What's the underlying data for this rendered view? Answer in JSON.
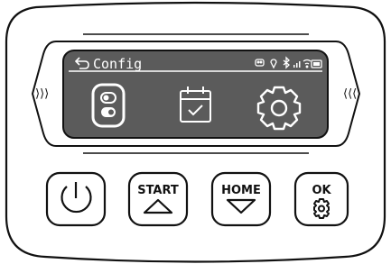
{
  "screen": {
    "back_icon": "return-arrow-icon",
    "title": "Config",
    "status_icons": [
      "robot-icon",
      "location-pin-icon",
      "bluetooth-icon",
      "signal-bars-icon",
      "wifi-icon",
      "battery-icon"
    ],
    "menu_icons": [
      {
        "name": "toggle-switch-icon",
        "selected": true
      },
      {
        "name": "calendar-check-icon",
        "selected": false
      },
      {
        "name": "gear-icon",
        "selected": false
      }
    ],
    "left_arrows": "⟩⟩⟩",
    "right_arrows": "⟨⟨⟨"
  },
  "buttons": {
    "power": {
      "icon": "power-icon"
    },
    "start": {
      "label": "START",
      "icon": "up-triangle-icon"
    },
    "home": {
      "label": "HOME",
      "icon": "down-triangle-icon"
    },
    "ok": {
      "label": "OK",
      "icon": "gear-icon"
    }
  },
  "colors": {
    "screen_bg": "#5b5b5b",
    "outline": "#111111",
    "panel_bg": "#ffffff",
    "glyph_white": "#ffffff"
  }
}
